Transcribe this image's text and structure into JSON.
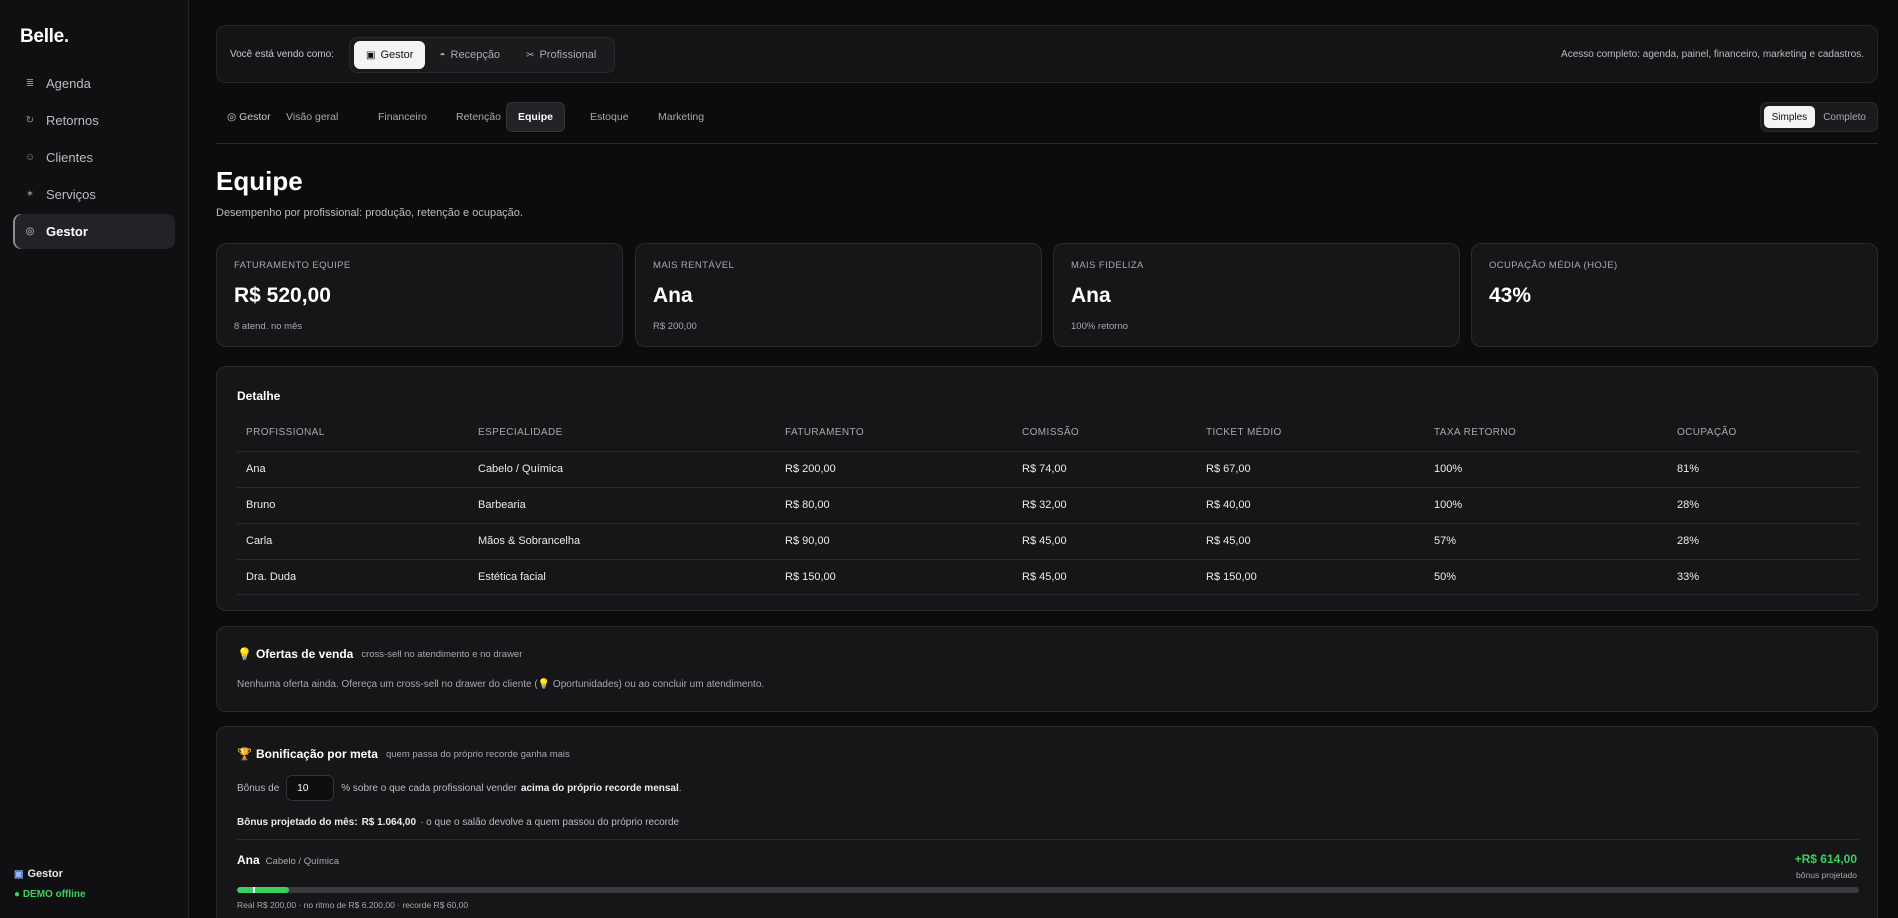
{
  "app": {
    "logo": "Belle",
    "logo_dot": "."
  },
  "sidebar": {
    "items": [
      {
        "label": "Agenda",
        "icon": "list-icon",
        "glyph": "≣"
      },
      {
        "label": "Retornos",
        "icon": "refresh-icon",
        "glyph": "↻"
      },
      {
        "label": "Clientes",
        "icon": "person-icon",
        "glyph": "☺"
      },
      {
        "label": "Serviços",
        "icon": "sparkle-icon",
        "glyph": "✶"
      },
      {
        "label": "Gestor",
        "icon": "target-icon",
        "glyph": "◎",
        "active": true
      }
    ],
    "role": "Gestor",
    "role_icon": "▣",
    "status": "● DEMO offline"
  },
  "rolebar": {
    "label": "Você está vendo como:",
    "roles": [
      {
        "label": "Gestor",
        "glyph": "▣",
        "active": true
      },
      {
        "label": "Recepção",
        "glyph": "◓"
      },
      {
        "label": "Profissional",
        "glyph": "✂"
      }
    ],
    "note": "Acesso completo: agenda, painel, financeiro, marketing e cadastros."
  },
  "tabs": {
    "items": [
      {
        "label": "◎ Gestor"
      },
      {
        "label": "Visão geral"
      },
      {
        "label": "Financeiro"
      },
      {
        "label": "Retenção"
      },
      {
        "label": "Equipe",
        "active": true
      },
      {
        "label": "Estoque"
      },
      {
        "label": "Marketing"
      }
    ],
    "mode": {
      "simple": "Simples",
      "full": "Completo",
      "selected": "Simples"
    }
  },
  "page": {
    "title": "Equipe",
    "subtitle": "Desempenho por profissional: produção, retenção e ocupação."
  },
  "kpis": [
    {
      "label": "FATURAMENTO EQUIPE",
      "value": "R$ 520,00",
      "sub": "8 atend. no mês"
    },
    {
      "label": "MAIS RENTÁVEL",
      "value": "Ana",
      "sub": "R$ 200,00"
    },
    {
      "label": "MAIS FIDELIZA",
      "value": "Ana",
      "sub": "100% retorno"
    },
    {
      "label": "OCUPAÇÃO MÉDIA (HOJE)",
      "value": "43%",
      "sub": ""
    }
  ],
  "detail": {
    "title": "Detalhe",
    "columns": [
      "PROFISSIONAL",
      "ESPECIALIDADE",
      "FATURAMENTO",
      "COMISSÃO",
      "TICKET MÉDIO",
      "TAXA RETORNO",
      "OCUPAÇÃO"
    ],
    "rows": [
      [
        "Ana",
        "Cabelo / Química",
        "R$ 200,00",
        "R$ 74,00",
        "R$ 67,00",
        "100%",
        "81%"
      ],
      [
        "Bruno",
        "Barbearia",
        "R$ 80,00",
        "R$ 32,00",
        "R$ 40,00",
        "100%",
        "28%"
      ],
      [
        "Carla",
        "Mãos & Sobrancelha",
        "R$ 90,00",
        "R$ 45,00",
        "R$ 45,00",
        "57%",
        "28%"
      ],
      [
        "Dra. Duda",
        "Estética facial",
        "R$ 150,00",
        "R$ 45,00",
        "R$ 150,00",
        "50%",
        "33%"
      ]
    ]
  },
  "offers": {
    "title": "Ofertas de venda",
    "icon": "lightbulb-icon",
    "glyph": "💡",
    "subtitle": "cross-sell no atendimento e no drawer",
    "empty_text": "Nenhuma oferta ainda. Ofereça um cross-sell no drawer do cliente (💡 Oportunidades) ou ao concluir um atendimento."
  },
  "bonus": {
    "title": "Bonificação por meta",
    "icon": "trophy-icon",
    "glyph": "🏆",
    "subtitle": "quem passa do próprio recorde ganha mais",
    "prefix": "Bônus de",
    "percent_value": "10",
    "mid_text": "% sobre o que cada profissional vender",
    "bold_text": "acima do próprio recorde mensal",
    "end_text": ".",
    "projected_label": "Bônus projetado do mês:",
    "projected_value": "R$ 1.064,00",
    "projected_suffix": "· o que o salão devolve a quem passou do próprio recorde",
    "professional": {
      "name": "Ana",
      "specialty": "Cabelo / Química",
      "amount": "+R$ 614,00",
      "amount_label": "bônus projetado",
      "progress": 0.032,
      "record_mark": 0.0097,
      "footer": "Real R$ 200,00 · no ritmo de R$ 6.200,00 · recorde R$ 60,00"
    }
  },
  "colors": {
    "accent_green": "#3ccf5f",
    "background": "#0c0c0d",
    "card": "#161618"
  }
}
